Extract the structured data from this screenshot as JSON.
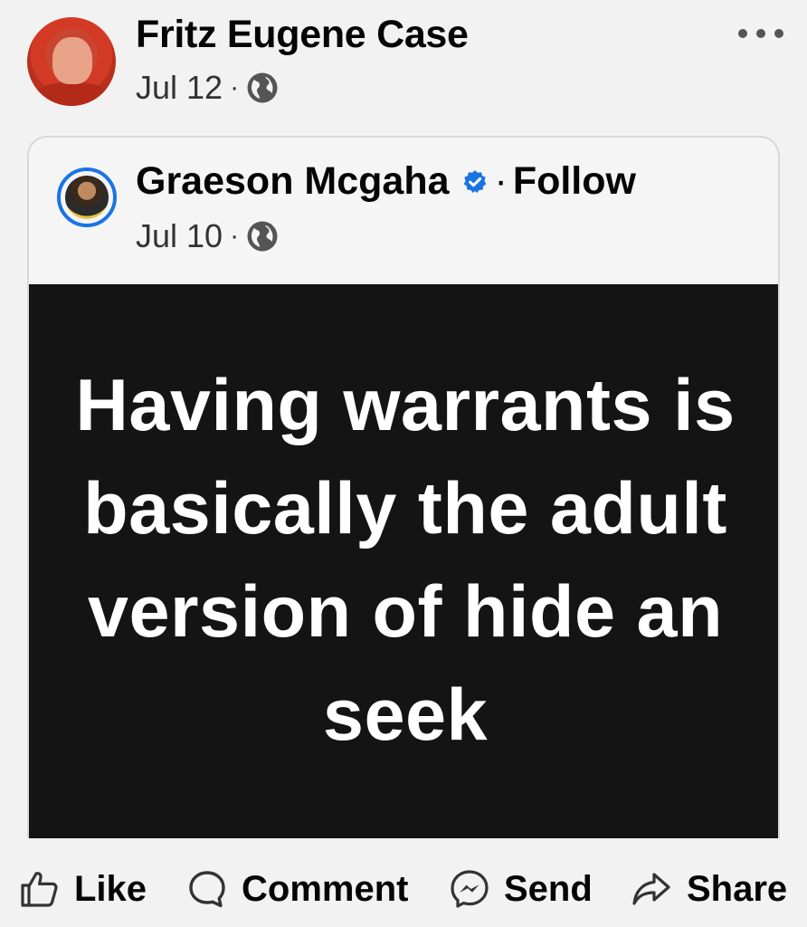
{
  "post": {
    "author": "Fritz Eugene Case",
    "date": "Jul 12",
    "separator": "·",
    "privacy_icon": "globe-icon",
    "more_icon": "more-options-icon"
  },
  "shared_post": {
    "author": "Graeson Mcgaha",
    "verified_icon": "verified-badge-icon",
    "follow_separator": "·",
    "follow_label": "Follow",
    "date": "Jul 10",
    "separator": "·",
    "privacy_icon": "globe-icon",
    "image_text": "Having warrants is basically the adult version of hide an seek",
    "image_background": "#141414",
    "image_text_color": "#ffffff"
  },
  "actions": {
    "like": "Like",
    "comment": "Comment",
    "send": "Send",
    "share": "Share"
  },
  "colors": {
    "verified_blue": "#1b74e4",
    "text": "#050505"
  }
}
